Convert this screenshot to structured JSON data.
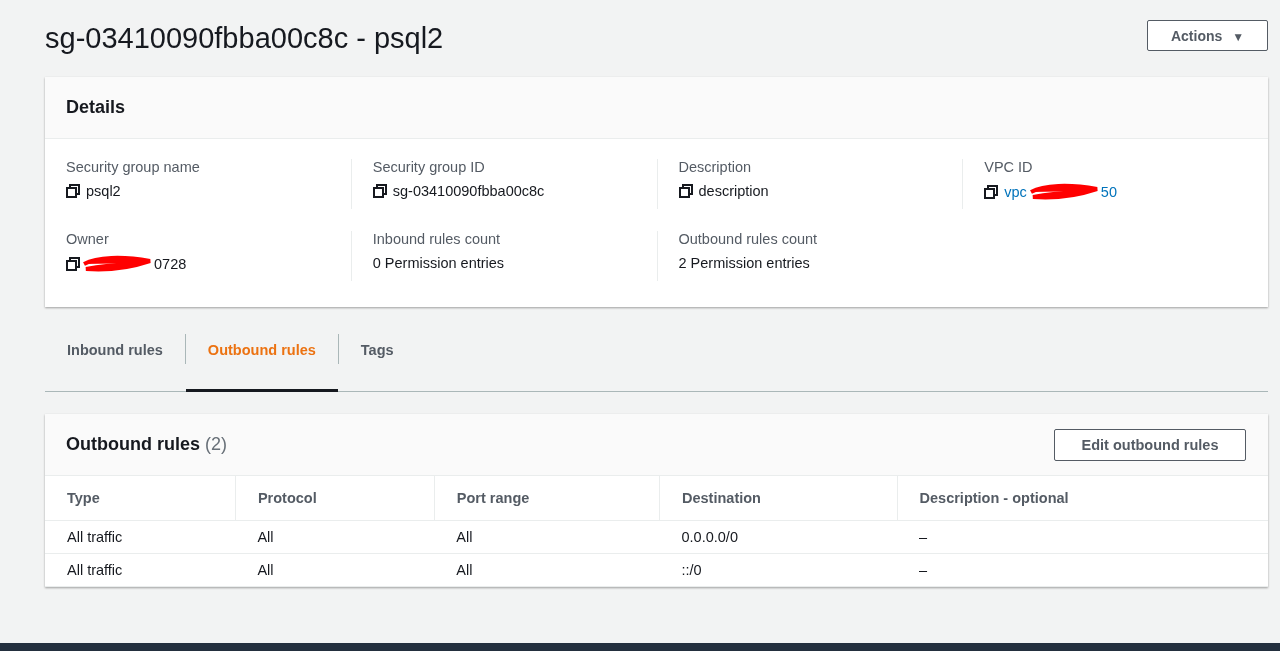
{
  "page_title": "sg-03410090fbba00c8c - psql2",
  "actions_button": {
    "label": "Actions",
    "caret": "▼"
  },
  "details": {
    "title": "Details",
    "fields": [
      {
        "label": "Security group name",
        "value": "psql2",
        "copy": true,
        "link": false,
        "redacted": false
      },
      {
        "label": "Security group ID",
        "value": "sg-03410090fbba00c8c",
        "copy": true,
        "link": false,
        "redacted": false
      },
      {
        "label": "Description",
        "value": "description",
        "copy": true,
        "link": false,
        "redacted": false
      },
      {
        "label": "VPC ID",
        "value": "vpc",
        "value_end": "50",
        "copy": true,
        "link": true,
        "redacted": true
      },
      {
        "label": "Owner",
        "value_end": "0728",
        "copy": true,
        "link": false,
        "redacted": true
      },
      {
        "label": "Inbound rules count",
        "value": "0 Permission entries",
        "copy": false,
        "link": false,
        "redacted": false
      },
      {
        "label": "Outbound rules count",
        "value": "2 Permission entries",
        "copy": false,
        "link": false,
        "redacted": false
      }
    ]
  },
  "tabs": [
    {
      "label": "Inbound rules",
      "selected": false
    },
    {
      "label": "Outbound rules",
      "selected": true
    },
    {
      "label": "Tags",
      "selected": false
    }
  ],
  "rules_panel": {
    "title": "Outbound rules",
    "count": "(2)",
    "edit_button": "Edit outbound rules",
    "columns": [
      "Type",
      "Protocol",
      "Port range",
      "Destination",
      "Description - optional"
    ],
    "rows": [
      [
        "All traffic",
        "All",
        "All",
        "0.0.0.0/0",
        "–"
      ],
      [
        "All traffic",
        "All",
        "All",
        "::/0",
        "–"
      ]
    ]
  }
}
